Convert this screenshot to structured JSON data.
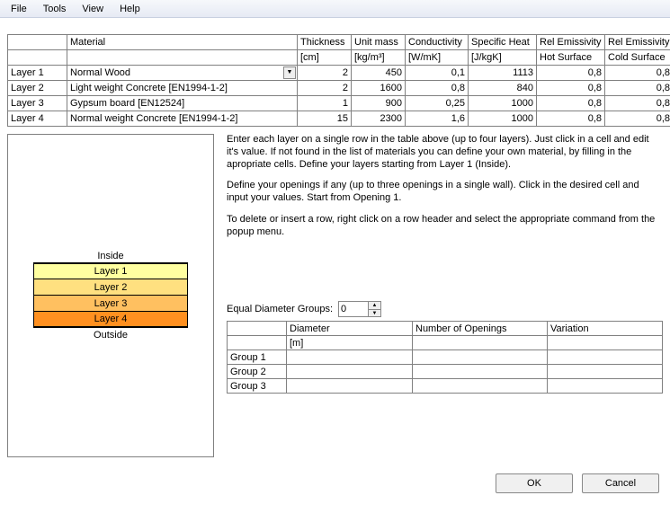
{
  "menu": {
    "file": "File",
    "tools": "Tools",
    "view": "View",
    "help": "Help"
  },
  "columns": {
    "rowhdr_blank": "",
    "material": "Material",
    "thickness": "Thickness",
    "thickness_unit": "[cm]",
    "unit_mass": "Unit mass",
    "unit_mass_unit": "[kg/m³]",
    "conductivity": "Conductivity",
    "conductivity_unit": "[W/mK]",
    "specific_heat": "Specific Heat",
    "specific_heat_unit": "[J/kgK]",
    "rel_em_hot": "Rel Emissivity",
    "hot_surf": "Hot Surface",
    "rel_em_cold": "Rel Emissivity",
    "cold_surf": "Cold Surface"
  },
  "layers": [
    {
      "name": "Layer 1",
      "material": "Normal Wood",
      "thickness": "2",
      "unit_mass": "450",
      "conductivity": "0,1",
      "specific_heat": "1113",
      "rel_hot": "0,8",
      "rel_cold": "0,8",
      "dropdown": true
    },
    {
      "name": "Layer 2",
      "material": "Light weight Concrete [EN1994-1-2]",
      "thickness": "2",
      "unit_mass": "1600",
      "conductivity": "0,8",
      "specific_heat": "840",
      "rel_hot": "0,8",
      "rel_cold": "0,8"
    },
    {
      "name": "Layer 3",
      "material": "Gypsum board [EN12524]",
      "thickness": "1",
      "unit_mass": "900",
      "conductivity": "0,25",
      "specific_heat": "1000",
      "rel_hot": "0,8",
      "rel_cold": "0,8"
    },
    {
      "name": "Layer 4",
      "material": "Normal weight Concrete [EN1994-1-2]",
      "thickness": "15",
      "unit_mass": "2300",
      "conductivity": "1,6",
      "specific_heat": "1000",
      "rel_hot": "0,8",
      "rel_cold": "0,8"
    }
  ],
  "diagram": {
    "inside": "Inside",
    "outside": "Outside",
    "l1": "Layer 1",
    "l2": "Layer 2",
    "l3": "Layer 3",
    "l4": "Layer 4"
  },
  "instructions": {
    "p1": "Enter each layer on a single row in the table above (up to four layers). Just click in a cell and edit it's value. If not found in the list of materials you can define your own material, by filling in the apropriate cells. Define your layers starting from Layer 1 (Inside).",
    "p2": "Define your openings if any (up to three openings in a single wall). Click in the desired cell and input your values. Start from Opening 1.",
    "p3": "To delete or insert a row, right click on a row header and select the appropriate command from the popup menu."
  },
  "equal_diameter": {
    "label": "Equal Diameter Groups:",
    "value": "0"
  },
  "openings_columns": {
    "diameter": "Diameter",
    "diameter_unit": "[m]",
    "num_openings": "Number of Openings",
    "variation": "Variation"
  },
  "openings_rows": [
    "Group 1",
    "Group 2",
    "Group 3"
  ],
  "buttons": {
    "ok": "OK",
    "cancel": "Cancel"
  }
}
